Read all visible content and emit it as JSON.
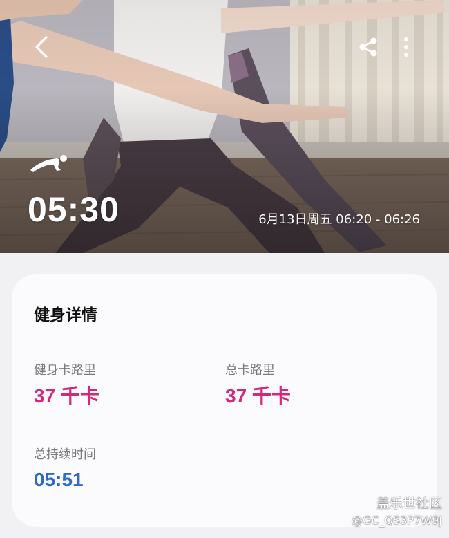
{
  "hero": {
    "duration": "05:30",
    "date_range": "6月13日周五 06:20 - 06:26",
    "icons": {
      "back": "back-arrow-icon",
      "share": "share-icon",
      "more": "more-vertical-icon",
      "workout": "yoga-pose-icon"
    }
  },
  "details": {
    "title": "健身详情",
    "stats": [
      {
        "label": "健身卡路里",
        "value": "37 千卡",
        "color": "#d3287b"
      },
      {
        "label": "总卡路里",
        "value": "37 千卡",
        "color": "#d3287b"
      },
      {
        "label": "总持续时间",
        "value": "05:51",
        "color": "#2c6bcc"
      }
    ]
  },
  "watermark": {
    "brand": "盖乐世社区",
    "user_id": "@GC_QS3P7W9J"
  }
}
